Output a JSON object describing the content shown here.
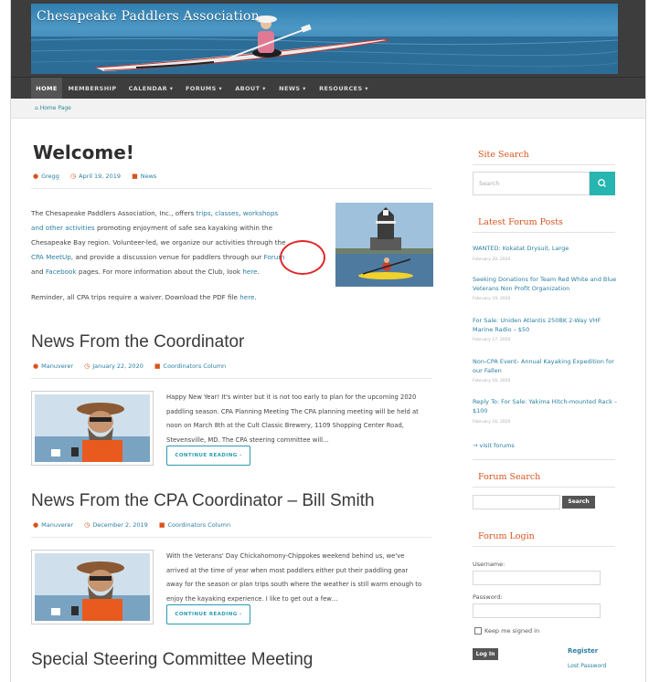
{
  "site": {
    "title": "Chesapeake Paddlers Association"
  },
  "nav": [
    {
      "label": "HOME",
      "active": true
    },
    {
      "label": "MEMBERSHIP"
    },
    {
      "label": "CALENDAR ▾"
    },
    {
      "label": "FORUMS ▾"
    },
    {
      "label": "ABOUT ▾"
    },
    {
      "label": "NEWS ▾"
    },
    {
      "label": "RESOURCES ▾"
    }
  ],
  "breadcrumb": {
    "label": "Home Page"
  },
  "welcome": {
    "title": "Welcome!",
    "author": "Gregg",
    "date": "April 19, 2019",
    "category": "News",
    "para1": {
      "t1": "The Chesapeake Paddlers Association, Inc., offers ",
      "l1": "trips",
      "t2": ", ",
      "l2": "classes",
      "t3": ", ",
      "l3": "workshops",
      "l4": "and other activities",
      "t4": " promoting enjoyment of safe sea kayaking within the",
      "line3": "Chesapeake Bay region. Volunteer-led, we organize our activities through the",
      "l5": "CPA MeetUp",
      "t5": ", and provide a discussion venue for paddlers through our ",
      "l6": "Forum",
      "t6": "and ",
      "l7": "Facebook",
      "t7": " pages. For more information about the Club, look ",
      "l8": "here",
      "t8": "."
    },
    "para2": {
      "text": "Reminder, all CPA trips require a waiver. Download the PDF file ",
      "link": "here",
      "end": "."
    }
  },
  "posts": [
    {
      "title": "News From the Coordinator",
      "author": "Manuverer",
      "date": "January 22, 2020",
      "category": "Coordinators Column",
      "excerpt": [
        "Happy New Year! It's winter but it is not too early to plan for the upcoming 2020",
        "paddling season. CPA Planning Meeting The CPA planning meeting will be held at",
        "noon on March 8th at the Cult Classic Brewery, 1109 Shopping Center Road,",
        "Stevensville, MD. The CPA steering committee will…"
      ],
      "button": "CONTINUE READING ›"
    },
    {
      "title": "News From the CPA Coordinator – Bill Smith",
      "author": "Manuverer",
      "date": "December 2, 2019",
      "category": "Coordinators Column",
      "excerpt": [
        "With the Veterans' Day Chickahomony-Chippokes weekend behind us, we've",
        "arrived at the time of year when most paddlers either put their paddling gear",
        "away for the season or plan trips south where the weather is still warm enough to",
        "enjoy the kayaking experience. I like to get out a few…"
      ],
      "button": "CONTINUE READING ›"
    },
    {
      "title": "Special Steering Committee Meeting"
    }
  ],
  "sidebar": {
    "search_title": "Site Search",
    "search_placeholder": "Search",
    "forum_posts_title": "Latest Forum Posts",
    "forum_posts": [
      {
        "title": "WANTED: Kokatat Drysuit, Large",
        "date": "February 20, 2020"
      },
      {
        "title": "Seeking Donations for Team Red White and Blue Veterans Non Profit Organization",
        "date": "February 19, 2020"
      },
      {
        "title": "For Sale: Uniden Atlantis 250BK 2-Way VHF Marine Radio – $50",
        "date": "February 17, 2020"
      },
      {
        "title": "Non-CPA Event- Annual Kayaking Expedition for our Fallen",
        "date": "February 16, 2020"
      },
      {
        "title": "Reply To: For Sale: Yakima Hitch-mounted Rack – $100",
        "date": "February 16, 2020"
      }
    ],
    "visit_forums": "→ visit forums",
    "forum_search_title": "Forum Search",
    "forum_search_button": "Search",
    "login_title": "Forum Login",
    "username_label": "Username:",
    "password_label": "Password:",
    "remember_label": "Keep me signed in",
    "login_button": "Log In",
    "register_link": "Register",
    "lost_password_link": "Lost Password"
  },
  "colors": {
    "accent": "#d9531e",
    "link": "#2a7fa0",
    "teal": "#26b5b0",
    "nav_bg": "#3d3d3d"
  }
}
